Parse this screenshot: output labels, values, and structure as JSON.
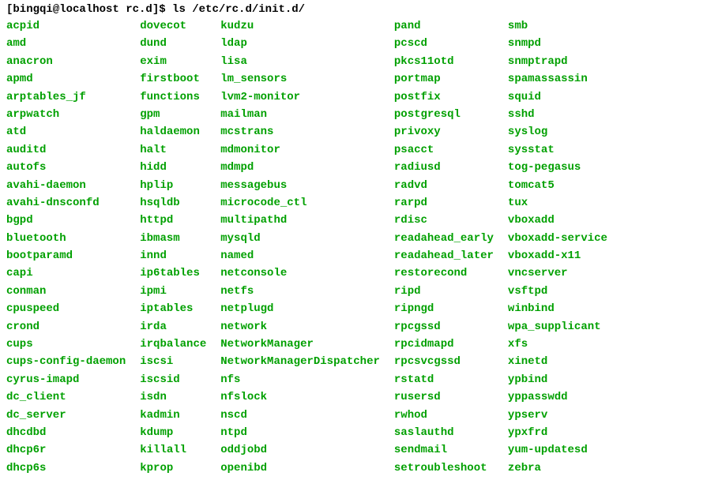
{
  "prompt": {
    "user_host_cwd": "[bingqi@localhost rc.d]$ ",
    "command": "ls /etc/rc.d/init.d/"
  },
  "columns": [
    [
      "acpid",
      "amd",
      "anacron",
      "apmd",
      "arptables_jf",
      "arpwatch",
      "atd",
      "auditd",
      "autofs",
      "avahi-daemon",
      "avahi-dnsconfd",
      "bgpd",
      "bluetooth",
      "bootparamd",
      "capi",
      "conman",
      "cpuspeed",
      "crond",
      "cups",
      "cups-config-daemon",
      "cyrus-imapd",
      "dc_client",
      "dc_server",
      "dhcdbd",
      "dhcp6r",
      "dhcp6s"
    ],
    [
      "dovecot",
      "dund",
      "exim",
      "firstboot",
      "functions",
      "gpm",
      "haldaemon",
      "halt",
      "hidd",
      "hplip",
      "hsqldb",
      "httpd",
      "ibmasm",
      "innd",
      "ip6tables",
      "ipmi",
      "iptables",
      "irda",
      "irqbalance",
      "iscsi",
      "iscsid",
      "isdn",
      "kadmin",
      "kdump",
      "killall",
      "kprop"
    ],
    [
      "kudzu",
      "ldap",
      "lisa",
      "lm_sensors",
      "lvm2-monitor",
      "mailman",
      "mcstrans",
      "mdmonitor",
      "mdmpd",
      "messagebus",
      "microcode_ctl",
      "multipathd",
      "mysqld",
      "named",
      "netconsole",
      "netfs",
      "netplugd",
      "network",
      "NetworkManager",
      "NetworkManagerDispatcher",
      "nfs",
      "nfslock",
      "nscd",
      "ntpd",
      "oddjobd",
      "openibd"
    ],
    [
      "pand",
      "pcscd",
      "pkcs11otd",
      "portmap",
      "postfix",
      "postgresql",
      "privoxy",
      "psacct",
      "radiusd",
      "radvd",
      "rarpd",
      "rdisc",
      "readahead_early",
      "readahead_later",
      "restorecond",
      "ripd",
      "ripngd",
      "rpcgssd",
      "rpcidmapd",
      "rpcsvcgssd",
      "rstatd",
      "rusersd",
      "rwhod",
      "saslauthd",
      "sendmail",
      "setroubleshoot"
    ],
    [
      "smb",
      "snmpd",
      "snmptrapd",
      "spamassassin",
      "squid",
      "sshd",
      "syslog",
      "sysstat",
      "tog-pegasus",
      "tomcat5",
      "tux",
      "vboxadd",
      "vboxadd-service",
      "vboxadd-x11",
      "vncserver",
      "vsftpd",
      "winbind",
      "wpa_supplicant",
      "xfs",
      "xinetd",
      "ypbind",
      "yppasswdd",
      "ypserv",
      "ypxfrd",
      "yum-updatesd",
      "zebra"
    ]
  ]
}
